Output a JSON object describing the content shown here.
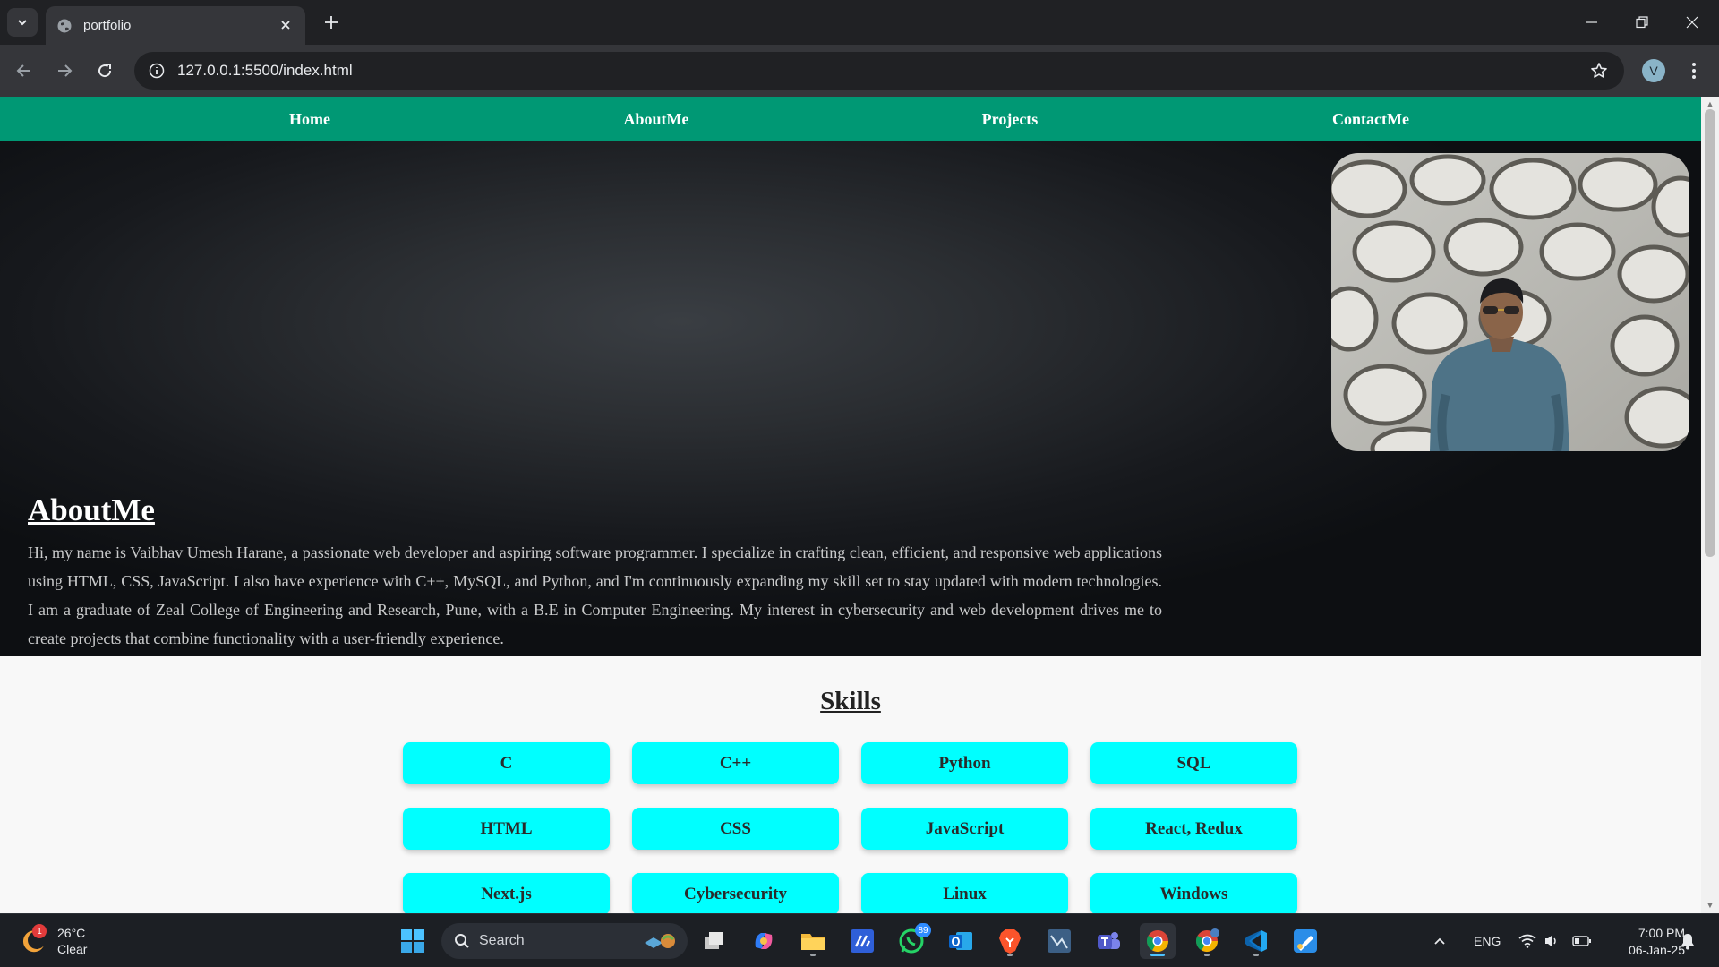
{
  "browser": {
    "tab_title": "portfolio",
    "url": "127.0.0.1:5500/index.html",
    "profile_initial": "V"
  },
  "site": {
    "nav": [
      {
        "label": "Home"
      },
      {
        "label": "AboutMe"
      },
      {
        "label": "Projects"
      },
      {
        "label": "ContactMe"
      }
    ],
    "about": {
      "title": "AboutMe",
      "text": "Hi, my name is Vaibhav Umesh Harane, a passionate web developer and aspiring software programmer. I specialize in crafting clean, efficient, and responsive web applications using HTML, CSS, JavaScript. I also have experience with C++, MySQL, and Python, and I'm continuously expanding my skill set to stay updated with modern technologies. I am a graduate of Zeal College of Engineering and Research, Pune, with a B.E in Computer Engineering. My interest in cybersecurity and web development drives me to create projects that combine functionality with a user-friendly experience."
    },
    "skills": {
      "title": "Skills",
      "items": [
        "C",
        "C++",
        "Python",
        "SQL",
        "HTML",
        "CSS",
        "JavaScript",
        "React, Redux",
        "Next.js",
        "Cybersecurity",
        "Linux",
        "Windows"
      ]
    },
    "colors": {
      "nav_bg": "#009874",
      "skill_bg": "#00ffff"
    }
  },
  "taskbar": {
    "weather": {
      "temp": "26°C",
      "condition": "Clear",
      "badge": "1"
    },
    "search_label": "Search",
    "whatsapp_badge": "89",
    "language": "ENG",
    "time": "7:00 PM",
    "date": "06-Jan-25"
  }
}
